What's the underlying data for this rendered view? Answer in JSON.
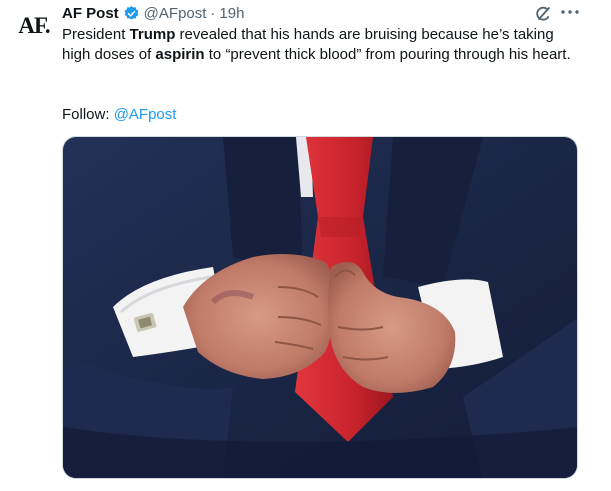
{
  "tweet": {
    "avatar_text": "AF.",
    "name": "AF Post",
    "handle": "@AFpost",
    "separator": "·",
    "time": "19h",
    "text": {
      "p1": "President ",
      "b1": "Trump",
      "p2": " revealed that his hands are bruising because he’s taking high doses of ",
      "b2": "aspirin",
      "p3": " to “prevent thick blood” from pouring through his heart."
    },
    "follow_label": "Follow: ",
    "follow_link": "@AFpost",
    "icons": {
      "verified": "verified-badge-icon",
      "grok": "grok-icon",
      "more": "more-icon"
    },
    "colors": {
      "link": "#1d9bf0",
      "verified": "#1d9bf0",
      "secondary": "#536471",
      "suit": "#1b2748",
      "tie": "#c8232c"
    }
  }
}
